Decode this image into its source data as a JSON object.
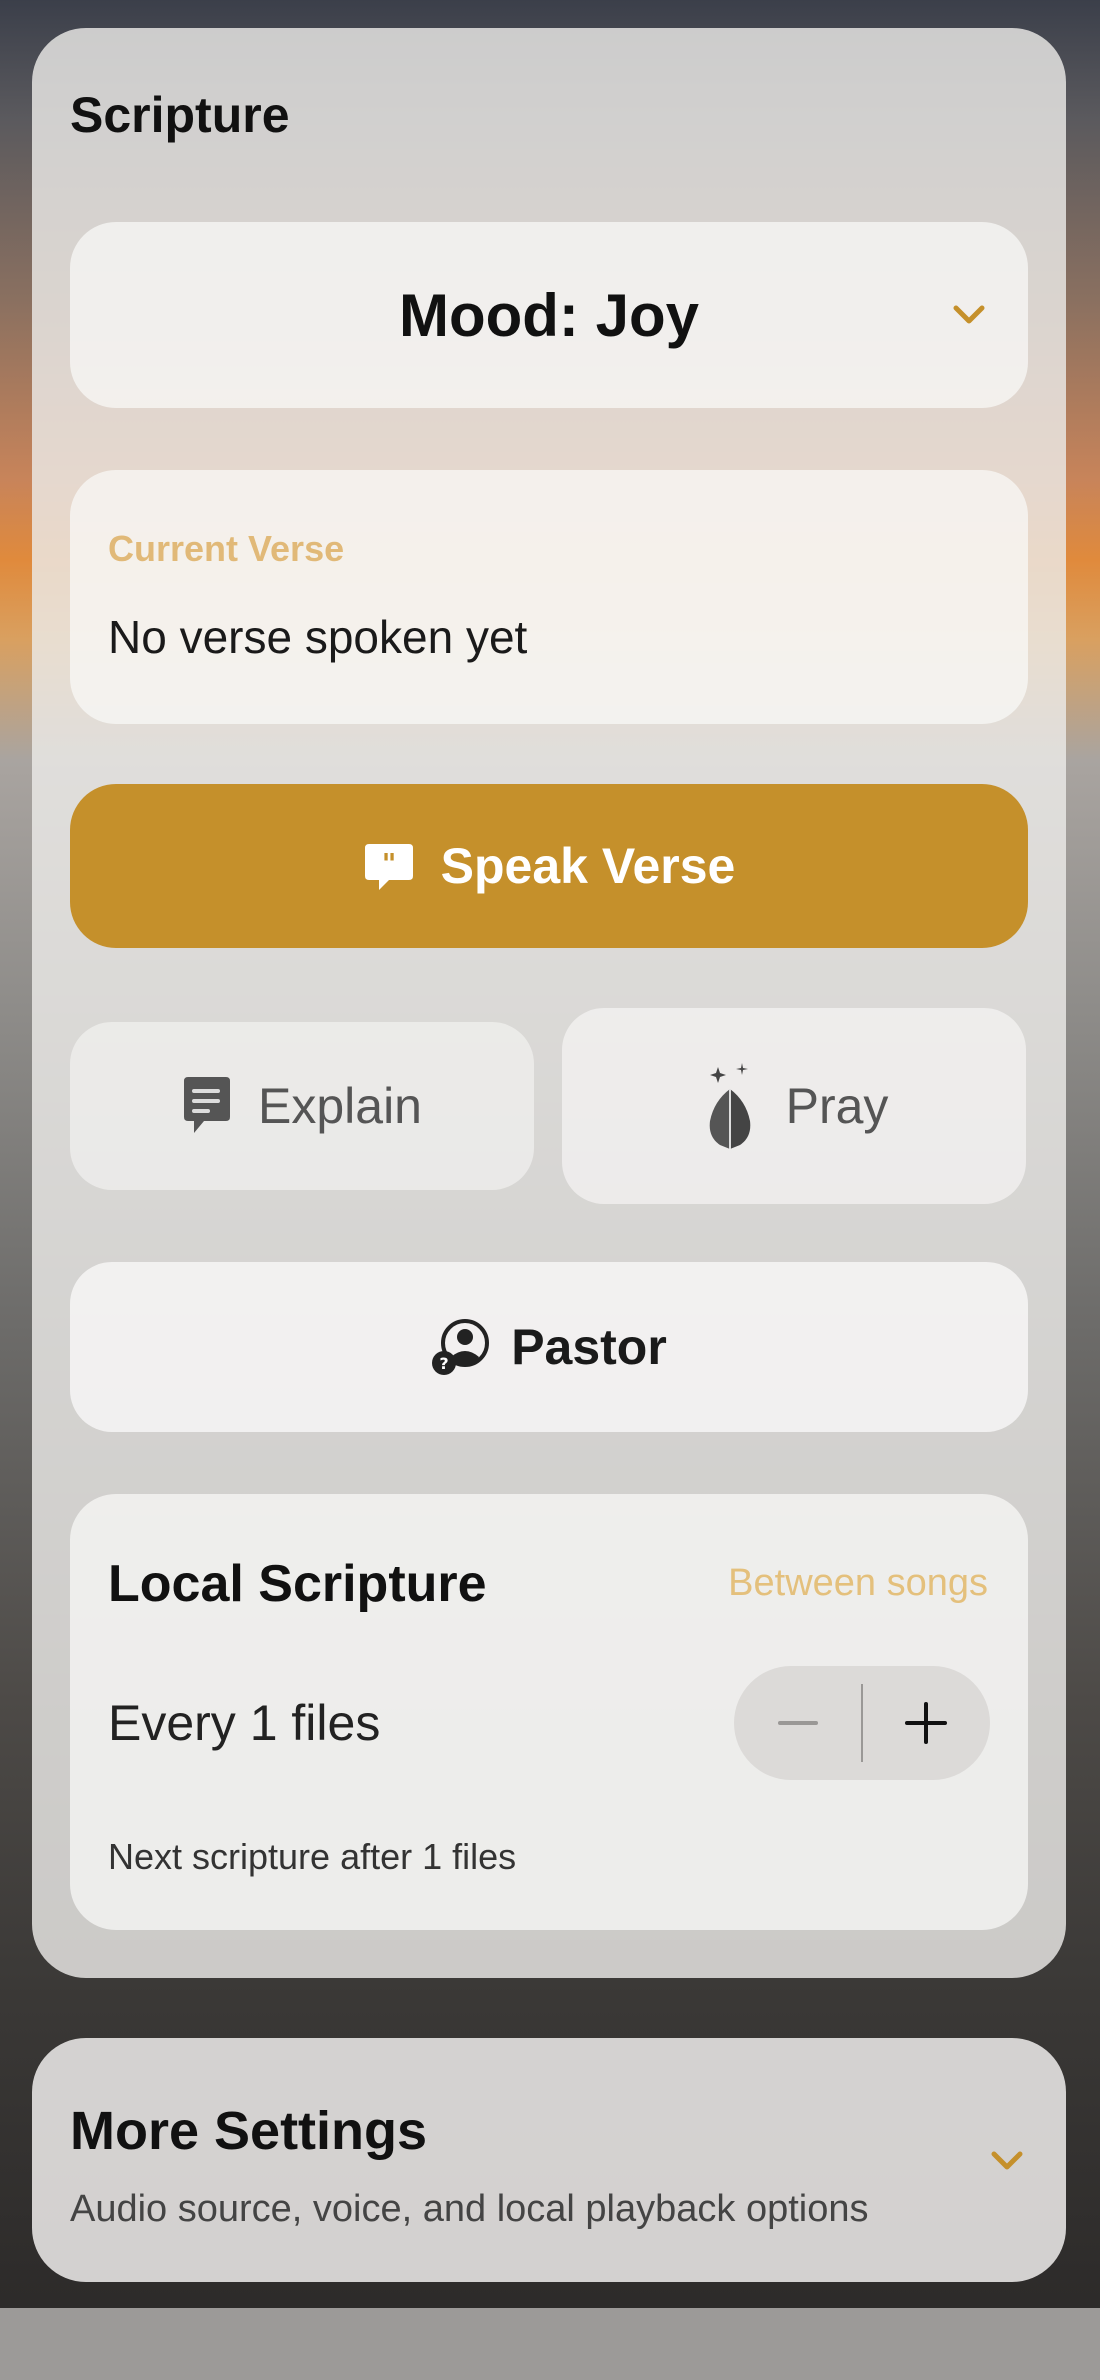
{
  "panel": {
    "title": "Scripture"
  },
  "mood": {
    "label": "Mood: Joy",
    "icon": "chevron-down-icon"
  },
  "current_verse": {
    "label": "Current Verse",
    "text": "No verse spoken yet"
  },
  "actions": {
    "speak": {
      "label": "Speak Verse",
      "icon": "quote-bubble-icon"
    },
    "explain": {
      "label": "Explain",
      "icon": "chat-bubble-icon"
    },
    "pray": {
      "label": "Pray",
      "icon": "praying-hands-icon"
    },
    "pastor": {
      "label": "Pastor",
      "icon": "pastor-person-icon"
    }
  },
  "local_scripture": {
    "title": "Local Scripture",
    "badge": "Between songs",
    "interval_label": "Every 1 files",
    "interval_value": 1,
    "minus_icon": "minus-icon",
    "plus_icon": "plus-icon",
    "next_text": "Next scripture after 1 files"
  },
  "more_settings": {
    "title": "More Settings",
    "subtitle": "Audio source, voice, and local playback options",
    "icon": "chevron-down-icon"
  },
  "colors": {
    "accent": "#c5902b",
    "accent_light": "#e1b978",
    "text_primary": "#111111",
    "text_muted": "#555555"
  }
}
